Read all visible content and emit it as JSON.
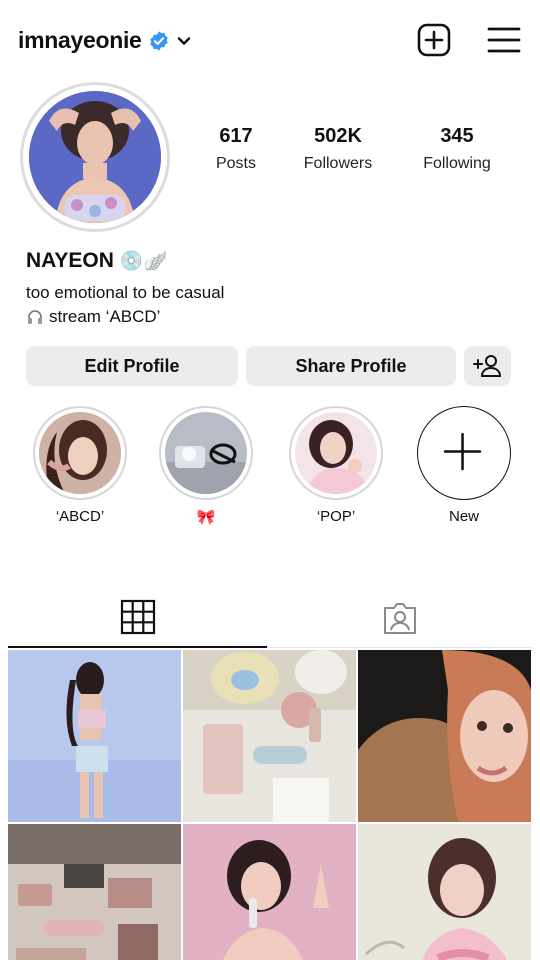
{
  "header": {
    "username": "imnayeonie",
    "add_icon": "plus-square-icon",
    "menu_icon": "hamburger-menu-icon"
  },
  "profile": {
    "stats": [
      {
        "value": "617",
        "label": "Posts"
      },
      {
        "value": "502K",
        "label": "Followers"
      },
      {
        "value": "345",
        "label": "Following"
      }
    ],
    "name": "NAYEON",
    "name_emoji": "💿🪽",
    "bio_line1": "too emotional to be casual",
    "bio_line2": "stream ‘ABCD’"
  },
  "buttons": {
    "edit": "Edit Profile",
    "share": "Share Profile"
  },
  "highlights": [
    {
      "label": "‘ABCD’"
    },
    {
      "label": "🎀"
    },
    {
      "label": "‘POP’"
    },
    {
      "label": "New"
    }
  ],
  "tabs": {
    "active": "grid",
    "items": [
      "grid-icon",
      "tagged-person-icon"
    ]
  },
  "colors": {
    "verified": "#3897f0",
    "button_bg": "#ececec",
    "ring": "#dcdcdc"
  }
}
